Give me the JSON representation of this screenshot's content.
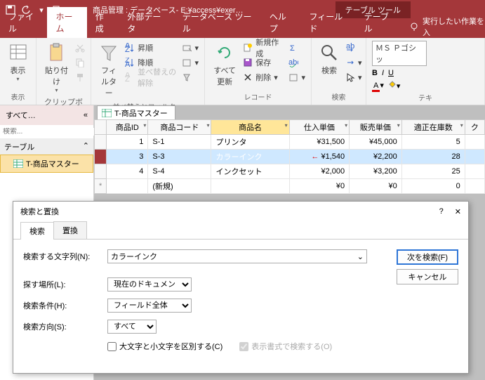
{
  "titlebar": {
    "title": "商品管理 : データベース- E:¥access¥exer…",
    "contextual": "テーブル ツール"
  },
  "tabs": {
    "items": [
      "ファイル",
      "ホーム",
      "作成",
      "外部データ",
      "データベース ツール",
      "ヘルプ",
      "フィールド",
      "テーブル"
    ],
    "active": 1,
    "tellme": "実行したい作業を入"
  },
  "ribbon": {
    "view": "表示",
    "paste": "貼り付け",
    "filter": "フィルター",
    "asc": "昇順",
    "desc": "降順",
    "clearsort": "並べ替えの解除",
    "refresh": "すべて\n更新",
    "new": "新規作成",
    "save": "保存",
    "delete": "削除",
    "find": "検索",
    "font": "ＭＳ Ｐゴシッ",
    "grp_clipboard": "クリップボード",
    "grp_sort": "並べ替えとフィルター",
    "grp_records": "レコード",
    "grp_find": "検索",
    "grp_text": "テキ"
  },
  "nav": {
    "title": "すべて…",
    "search_ph": "検索...",
    "cat": "テーブル",
    "item": "T-商品マスター"
  },
  "sheet": {
    "tab": "T-商品マスター",
    "cols": [
      "商品ID",
      "商品コード",
      "商品名",
      "仕入単価",
      "販売単価",
      "適正在庫数",
      "ク"
    ],
    "rows": [
      {
        "id": "1",
        "code": "S-1",
        "name": "プリンタ",
        "cost": "¥31,500",
        "price": "¥45,000",
        "stock": "5"
      },
      {
        "id": "3",
        "code": "S-3",
        "name": "カラーインク",
        "cost": "¥1,540",
        "price": "¥2,200",
        "stock": "28",
        "sel": true,
        "hl": true
      },
      {
        "id": "4",
        "code": "S-4",
        "name": "インクセット",
        "cost": "¥2,000",
        "price": "¥3,200",
        "stock": "25"
      }
    ],
    "newrow": "(新規)",
    "zero": "¥0",
    "stock0": "0"
  },
  "dialog": {
    "title": "検索と置換",
    "tab_find": "検索",
    "tab_replace": "置換",
    "lbl_findwhat": "検索する文字列(N):",
    "val_findwhat": "カラーインク",
    "lbl_lookin": "探す場所(L):",
    "val_lookin": "現在のドキュメント",
    "lbl_match": "検索条件(H):",
    "val_match": "フィールド全体",
    "lbl_dir": "検索方向(S):",
    "val_dir": "すべて",
    "chk_case": "大文字と小文字を区別する(C)",
    "chk_format": "表示書式で検索する(O)",
    "btn_findnext": "次を検索(F)",
    "btn_cancel": "キャンセル"
  }
}
